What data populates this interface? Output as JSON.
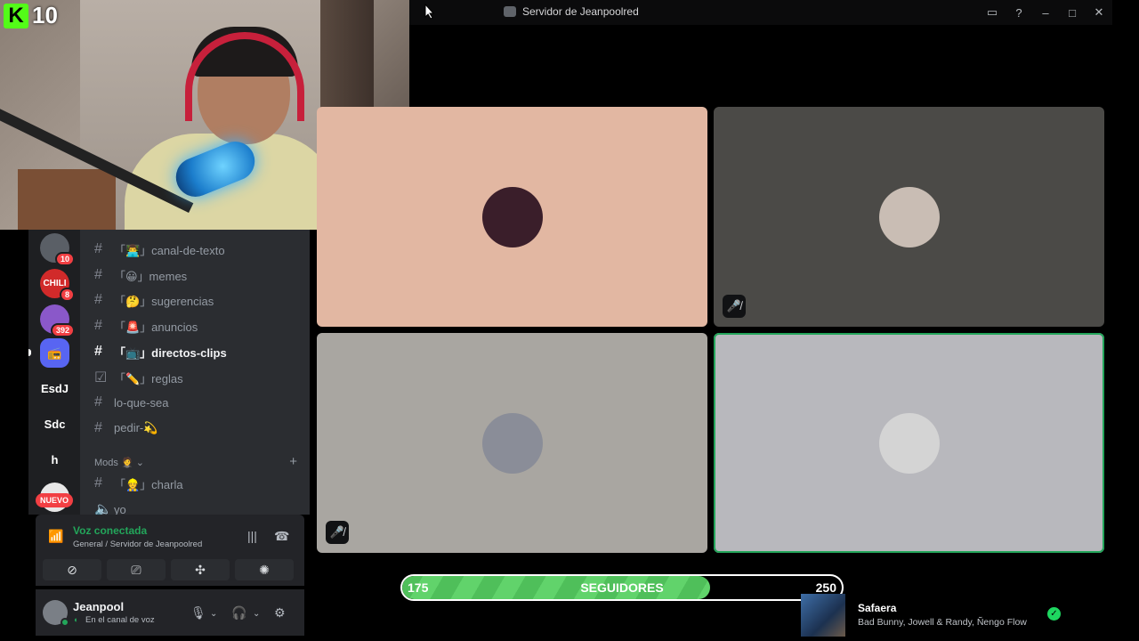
{
  "window": {
    "title": "Servidor de Jeanpoolred",
    "icons": [
      "inbox-icon",
      "help-icon",
      "minimize-icon",
      "maximize-icon",
      "close-icon"
    ]
  },
  "webcam": {
    "kick_logo": "K",
    "kick_count": "10"
  },
  "servers": [
    {
      "name": "server-avatar-1",
      "badge": "10"
    },
    {
      "name": "CHILI",
      "badge": "8"
    },
    {
      "name": "server-avatar-3",
      "badge": "392"
    },
    {
      "name": "server-radio",
      "badge": ""
    },
    {
      "name": "EsdJ",
      "badge": ""
    },
    {
      "name": "Sdc",
      "badge": ""
    },
    {
      "name": "h",
      "badge": ""
    }
  ],
  "rail_nuevo": "NUEVO",
  "channels": [
    {
      "label": "「👨‍💻」canal-de-texto",
      "active": false
    },
    {
      "label": "「😀」memes",
      "active": false
    },
    {
      "label": "「🤔」sugerencias",
      "active": false
    },
    {
      "label": "「🚨」anuncios",
      "active": false
    },
    {
      "label": "「📺」directos-clips",
      "active": true
    },
    {
      "label": "「✏️」reglas",
      "active": false
    },
    {
      "label": "lo-que-sea",
      "active": false
    },
    {
      "label": "pedir-💫",
      "active": false
    }
  ],
  "category": {
    "label": "Mods 🤵"
  },
  "mods_channels": [
    {
      "label": "「👷」charla"
    },
    {
      "label": "yo"
    }
  ],
  "voice": {
    "title": "Voz conectada",
    "subtitle": "General / Servidor de Jeanpoolred"
  },
  "user": {
    "name": "Jeanpool",
    "status": "En el canal de voz"
  },
  "tiles": [
    {
      "name": "participant-1",
      "bg": "#e2b7a2",
      "avatar": "#3a1e2a",
      "muted": false,
      "speaking": false
    },
    {
      "name": "participant-2",
      "bg": "#4b4a47",
      "avatar": "#c9bdb4",
      "muted": true,
      "speaking": false
    },
    {
      "name": "participant-3",
      "bg": "#a9a6a1",
      "avatar": "#8a8d98",
      "muted": true,
      "speaking": false
    },
    {
      "name": "participant-4",
      "bg": "#b8b8bd",
      "avatar": "#d4d4d4",
      "muted": false,
      "speaking": true
    }
  ],
  "followers": {
    "current": "175",
    "label": "SEGUIDORES",
    "goal": "250",
    "progress": 0.7
  },
  "now_playing": {
    "title": "Safaera",
    "artist": "Bad Bunny, Jowell & Randy, Ñengo Flow"
  },
  "colors": {
    "online_green": "#23a55a",
    "discord_bg": "#2b2d31",
    "badge_red": "#f23f43"
  }
}
